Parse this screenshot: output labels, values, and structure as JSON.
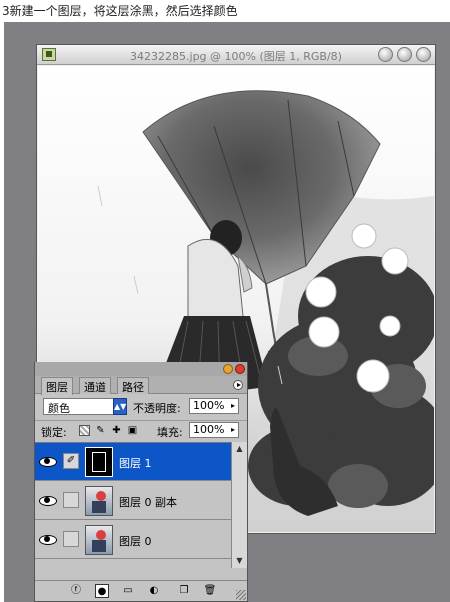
{
  "caption": "3新建一个图层，将这层涂黑，然后选择颜色",
  "document": {
    "title": "34232285.jpg @ 100% (图层 1, RGB/8)"
  },
  "layers_panel": {
    "tabs": [
      "图层",
      "通道",
      "路径"
    ],
    "blend_mode": "颜色",
    "opacity_label": "不透明度:",
    "opacity_value": "100%",
    "lock_label": "锁定:",
    "fill_label": "填充:",
    "fill_value": "100%",
    "layers": [
      {
        "name": "图层 1",
        "selected": true,
        "visible": true
      },
      {
        "name": "图层 0 副本",
        "selected": false,
        "visible": true
      },
      {
        "name": "图层 0",
        "selected": false,
        "visible": true
      }
    ]
  },
  "colors": {
    "desktop": "#7f7f84",
    "selection": "#0c56c8",
    "panel": "#c4c4c4"
  },
  "icons": [
    "app-icon",
    "eye-icon",
    "brush-icon",
    "link-icon",
    "lock-transparent-icon",
    "lock-paint-icon",
    "lock-move-icon",
    "lock-all-icon",
    "add-style-icon",
    "add-mask-icon",
    "new-group-icon",
    "adjustment-layer-icon",
    "new-layer-icon",
    "trash-icon",
    "panel-menu-icon"
  ]
}
